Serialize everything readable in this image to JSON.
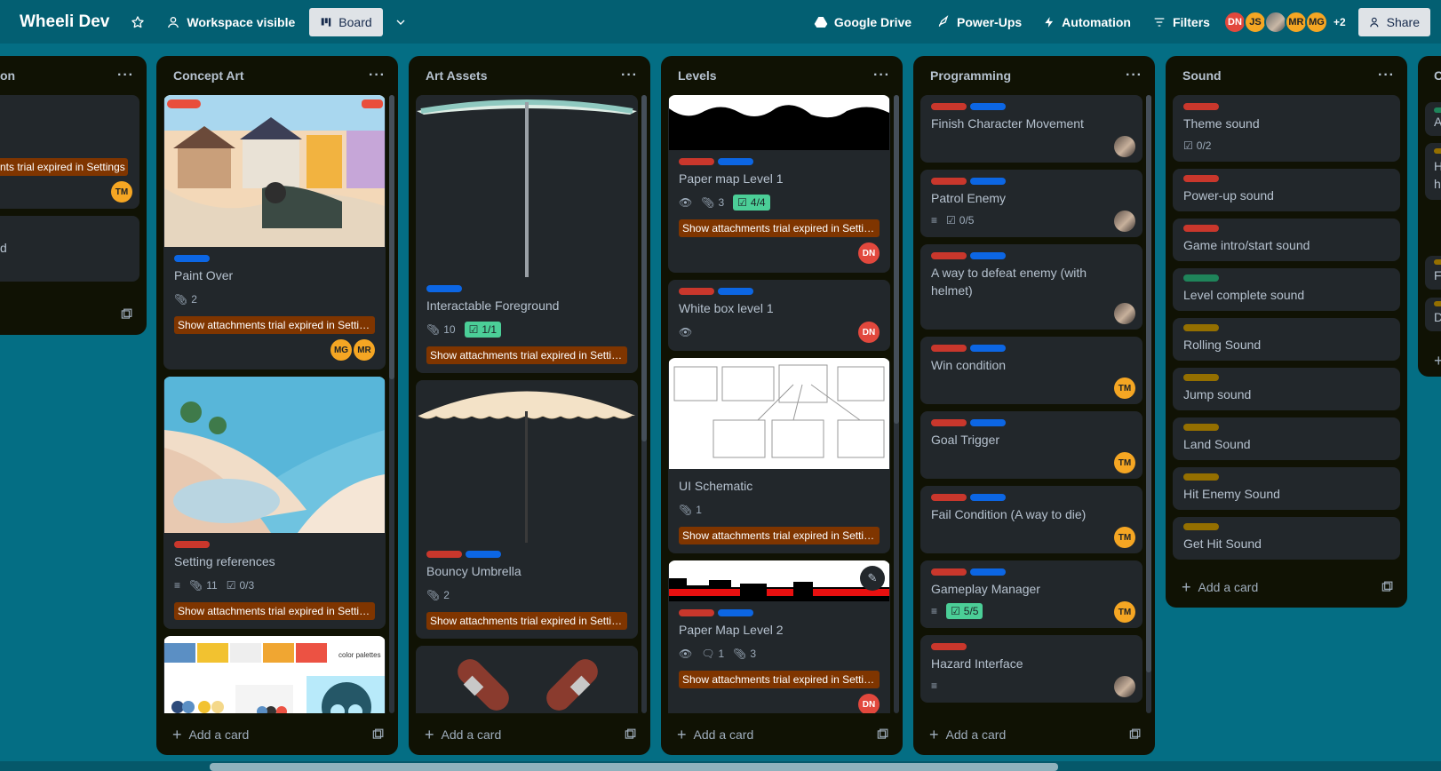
{
  "header": {
    "title": "Wheeli Dev",
    "visibility": "Workspace visible",
    "view": "Board",
    "google_drive": "Google Drive",
    "power_ups": "Power-Ups",
    "automation": "Automation",
    "filters": "Filters",
    "avatars": [
      "DN",
      "JS",
      "MR",
      "MG"
    ],
    "more_members": "+2",
    "share": "Share"
  },
  "lists": {
    "first": {
      "title_fragment": "on",
      "card1_banner": "nts trial expired in Settings",
      "card1_member": "TM",
      "card2_fragment": "d"
    },
    "concept_art": {
      "title": "Concept Art",
      "card1": {
        "title": "Paint Over",
        "attachments": "2",
        "banner": "Show attachments trial expired in Settin...",
        "members": [
          "MG",
          "MR"
        ]
      },
      "card2": {
        "title": "Setting references",
        "attachments": "11",
        "checklist": "0/3",
        "banner": "Show attachments trial expired in Settin..."
      },
      "card3": {
        "cover_text": "color palettes"
      },
      "add": "Add a card"
    },
    "art_assets": {
      "title": "Art Assets",
      "card1": {
        "title": "Interactable Foreground",
        "attachments": "10",
        "checklist": "1/1",
        "banner": "Show attachments trial expired in Settin..."
      },
      "card2": {
        "title": "Bouncy Umbrella",
        "attachments": "2",
        "banner": "Show attachments trial expired in Settin..."
      },
      "add": "Add a card"
    },
    "levels": {
      "title": "Levels",
      "card1": {
        "title": "Paper map Level 1",
        "attachments": "3",
        "checklist": "4/4",
        "banner": "Show attachments trial expired in Settin...",
        "member": "DN"
      },
      "card2": {
        "title": "White box level 1",
        "member": "DN"
      },
      "card3": {
        "title": "UI Schematic",
        "attachments": "1",
        "banner": "Show attachments trial expired in Settin..."
      },
      "card4": {
        "title": "Paper Map Level 2",
        "comments": "1",
        "attachments": "3",
        "banner": "Show attachments trial expired in Settin...",
        "member": "DN"
      },
      "add": "Add a card"
    },
    "programming": {
      "title": "Programming",
      "cards": [
        {
          "title": "Finish Character Movement"
        },
        {
          "title": "Patrol Enemy",
          "checklist": "0/5"
        },
        {
          "title": "A way to defeat enemy (with helmet)"
        },
        {
          "title": "Win condition",
          "member": "TM"
        },
        {
          "title": "Goal Trigger",
          "member": "TM"
        },
        {
          "title": "Fail Condition (A way to die)",
          "member": "TM"
        },
        {
          "title": "Gameplay Manager",
          "checklist": "5/5",
          "member": "TM"
        },
        {
          "title": "Hazard Interface"
        }
      ],
      "add": "Add a card"
    },
    "sound": {
      "title": "Sound",
      "cards": [
        {
          "title": "Theme sound",
          "checklist": "0/2"
        },
        {
          "title": "Power-up sound"
        },
        {
          "title": "Game intro/start sound"
        },
        {
          "title": "Level complete sound"
        },
        {
          "title": "Rolling Sound"
        },
        {
          "title": "Jump sound"
        },
        {
          "title": "Land Sound"
        },
        {
          "title": "Hit Enemy Sound"
        },
        {
          "title": "Get Hit Sound"
        }
      ],
      "add": "Add a card"
    },
    "next": {
      "fragments": [
        "C",
        "A",
        "H",
        "h",
        "F",
        "D"
      ]
    }
  },
  "colors": {
    "board_bg": "#046e84",
    "list_bg": "#101204",
    "card_bg": "#22272b",
    "label_red": "#c9372c",
    "label_blue": "#0c66e4",
    "label_green": "#1f845a",
    "label_yellow": "#946f00",
    "banner": "#7f3500",
    "checklist_done": "#4bce97"
  }
}
